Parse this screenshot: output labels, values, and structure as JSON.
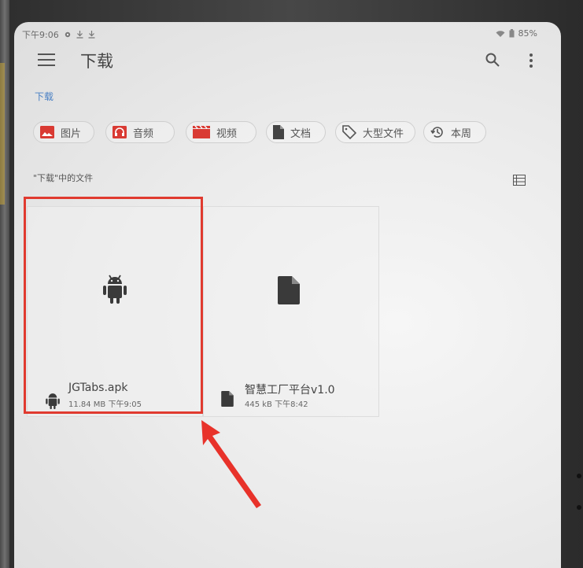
{
  "status_bar": {
    "time": "下午9:06",
    "battery": "85%"
  },
  "app_bar": {
    "title": "下载",
    "menu_icon": "menu-icon",
    "search_icon": "search-icon",
    "more_icon": "more-vert-icon"
  },
  "breadcrumb": "下载",
  "chips": [
    {
      "label": "图片",
      "icon": "image-icon",
      "color": "#d93a33"
    },
    {
      "label": "音频",
      "icon": "audio-icon",
      "color": "#d93a33"
    },
    {
      "label": "视频",
      "icon": "video-icon",
      "color": "#d93a33"
    },
    {
      "label": "文档",
      "icon": "document-icon",
      "color": "#444444"
    },
    {
      "label": "大型文件",
      "icon": "tag-icon",
      "color": "#555555"
    },
    {
      "label": "本周",
      "icon": "history-icon",
      "color": "#555555"
    }
  ],
  "section_label": "\"下载\"中的文件",
  "files": [
    {
      "name": "JGTabs.apk",
      "size": "11.84 MB",
      "time": "下午9:05",
      "icon": "android-icon"
    },
    {
      "name": "智慧工厂平台v1.0",
      "size": "445 kB",
      "time": "下午8:42",
      "icon": "file-icon"
    }
  ],
  "colors": {
    "accent": "#4a80c4",
    "highlight": "#e03a2f"
  }
}
